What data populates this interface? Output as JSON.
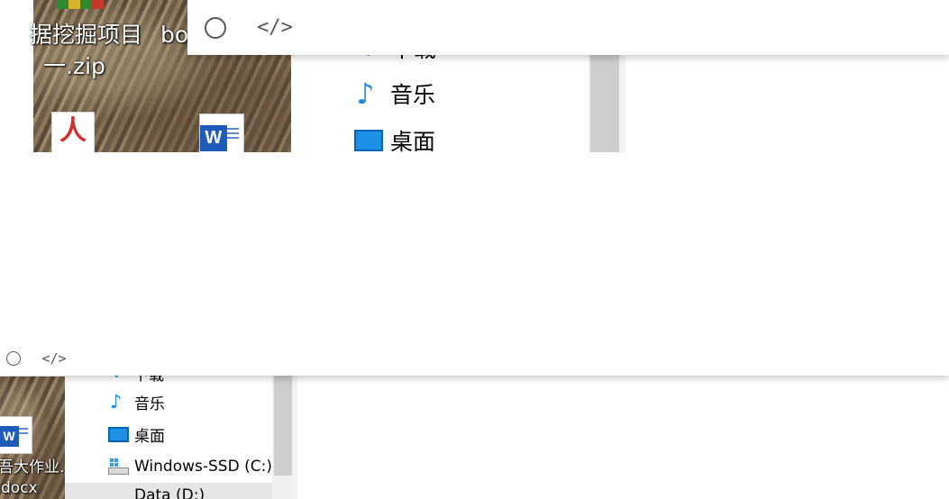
{
  "toolbar": {
    "record_icon": "circle-icon",
    "code_icon": "code-icon",
    "code_glyph": "</>"
  },
  "desktop": {
    "top_label_line1": "据挖掘项目",
    "top_label_line1_b": "bo",
    "top_label_line2": "一.zip",
    "bottom_label_line1": "吾大作业.",
    "bottom_label_line2": "docx",
    "word_letter": "W",
    "pdf_letter": "人"
  },
  "nav": {
    "partial_top": "下载",
    "music": "音乐",
    "desktop": "桌面",
    "windows_drive": "Windows-SSD (C:)",
    "data_drive": "Data (D:)"
  },
  "colors": {
    "accent_blue": "#1e88e5",
    "word_blue": "#1f5bb8",
    "selected_row": "#e5e5e5"
  }
}
